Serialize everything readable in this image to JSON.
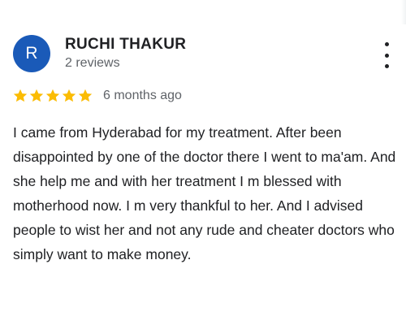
{
  "reviewer": {
    "avatar_letter": "R",
    "avatar_color": "#1a5ab8",
    "name": "RUCHI THAKUR",
    "review_count": "2 reviews"
  },
  "review": {
    "rating": 5,
    "max_rating": 5,
    "star_color": "#fbbc04",
    "time_ago": "6 months ago",
    "text": "I came from Hyderabad for my treatment. After been disappointed by one of the doctor there I went to ma'am. And she help me and with her treatment I m blessed with motherhood now. I m very thankful to her. And I advised people to wist her and not any rude and cheater doctors who simply want to make money."
  },
  "actions": {
    "more_icon": "more-vert-icon"
  }
}
